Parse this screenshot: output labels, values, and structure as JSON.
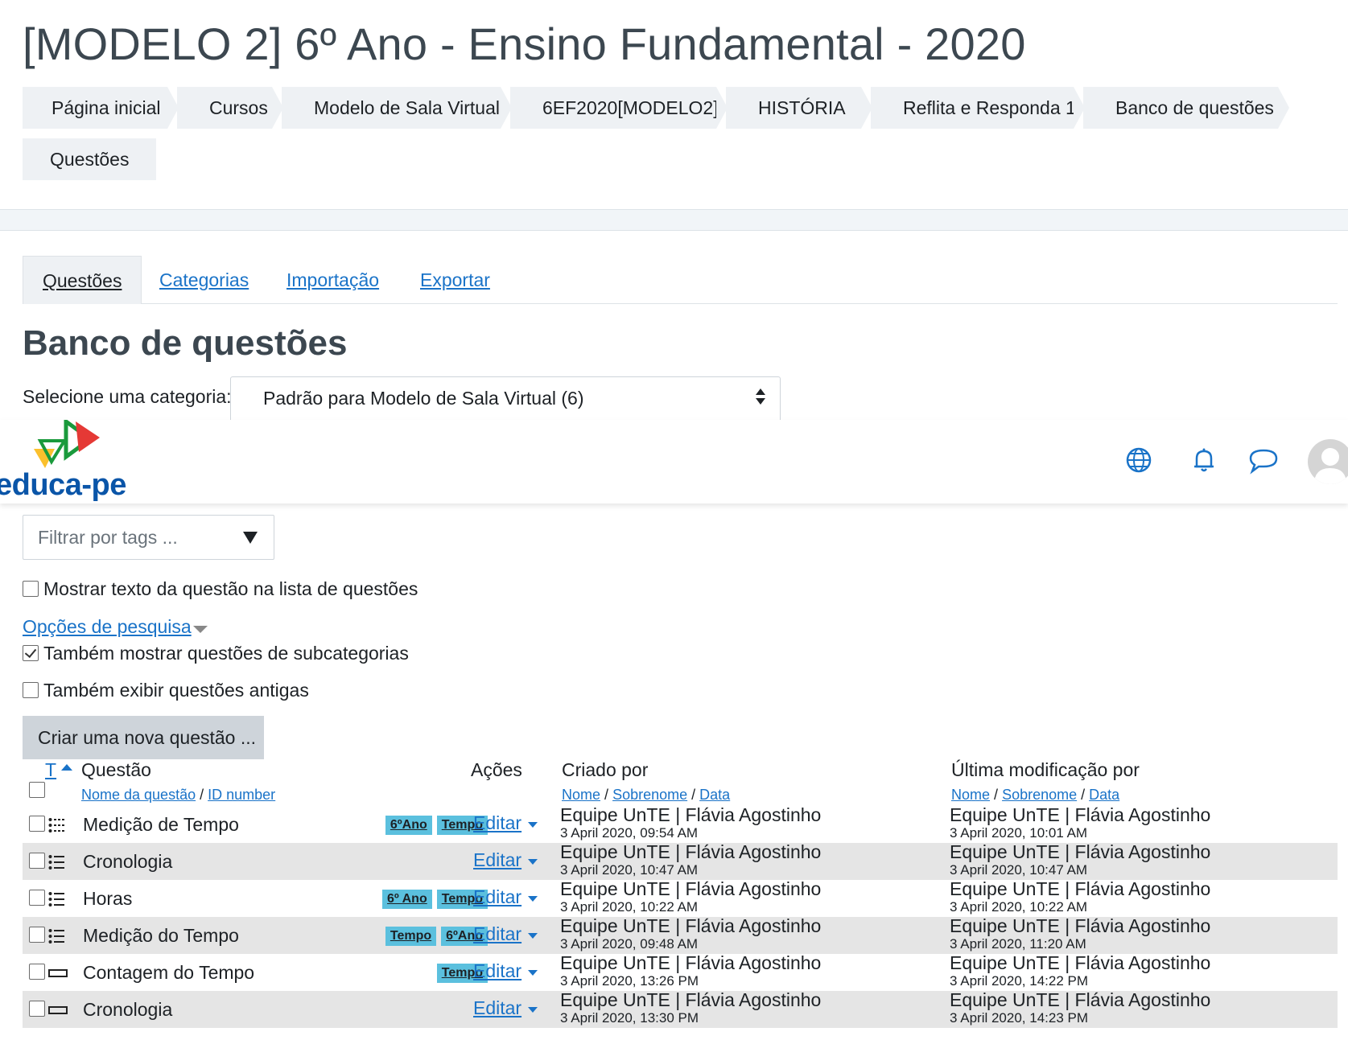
{
  "page_title": "[MODELO 2] 6º Ano - Ensino Fundamental - 2020",
  "breadcrumb": [
    "Página inicial",
    "Cursos",
    "Modelo de Sala Virtual",
    "6EF2020[MODELO2]",
    "HISTÓRIA",
    "Reflita e Responda 1",
    "Banco de questões",
    "Questões"
  ],
  "tabs": [
    "Questões",
    "Categorias",
    "Importação",
    "Exportar"
  ],
  "section_title": "Banco de questões",
  "category": {
    "label": "Selecione uma categoria:",
    "value": "Padrão para Modelo de Sala Virtual (6)"
  },
  "navbar": {
    "logo_text": "educa-pe",
    "icons": [
      "globe-icon",
      "bell-icon",
      "chat-icon",
      "user-avatar-icon"
    ]
  },
  "tag_filter": {
    "placeholder": "Filtrar por tags ..."
  },
  "options": {
    "show_text": {
      "label": "Mostrar texto da questão na lista de questões",
      "checked": false
    },
    "search_options": "Opções de pesquisa",
    "subcategories": {
      "label": "Também mostrar questões de subcategorias",
      "checked": true
    },
    "old_questions": {
      "label": "Também exibir questões antigas",
      "checked": false
    }
  },
  "create_button": "Criar uma nova questão ...",
  "table": {
    "headers": {
      "type": "T",
      "question": "Questão",
      "actions": "Ações",
      "created_by": "Criado por",
      "modified_by": "Última modificação por"
    },
    "question_sub": {
      "name": "Nome da questão",
      "sep": "/",
      "id": "ID number"
    },
    "person_sub": {
      "first": "Nome",
      "sep1": "/",
      "last": "Sobrenome",
      "sep2": "/",
      "date": "Data"
    },
    "edit_label": "Editar",
    "rows": [
      {
        "type": "multichoice-icon",
        "name": "Medição de Tempo",
        "tags": [
          "6ºAno",
          "Tempo"
        ],
        "created_by": "Equipe UnTE | Flávia Agostinho",
        "created": "3 April 2020, 09:54 AM",
        "modified_by": "Equipe UnTE | Flávia Agostinho",
        "modified": "3 April 2020, 10:01 AM"
      },
      {
        "type": "list-icon",
        "name": "Cronologia",
        "tags": [],
        "created_by": "Equipe UnTE | Flávia Agostinho",
        "created": "3 April 2020, 10:47 AM",
        "modified_by": "Equipe UnTE | Flávia Agostinho",
        "modified": "3 April 2020, 10:47 AM"
      },
      {
        "type": "list-icon",
        "name": "Horas",
        "tags": [
          "6º Ano",
          "Tempo"
        ],
        "created_by": "Equipe UnTE | Flávia Agostinho",
        "created": "3 April 2020, 10:22 AM",
        "modified_by": "Equipe UnTE | Flávia Agostinho",
        "modified": "3 April 2020, 10:22 AM"
      },
      {
        "type": "list-icon",
        "name": "Medição do Tempo",
        "tags": [
          "Tempo",
          "6ºAno"
        ],
        "created_by": "Equipe UnTE | Flávia Agostinho",
        "created": "3 April 2020, 09:48 AM",
        "modified_by": "Equipe UnTE | Flávia Agostinho",
        "modified": "3 April 2020, 11:20 AM"
      },
      {
        "type": "short-answer-icon",
        "name": "Contagem do Tempo",
        "tags": [
          "Tempo"
        ],
        "created_by": "Equipe UnTE | Flávia Agostinho",
        "created": "3 April 2020, 13:26 PM",
        "modified_by": "Equipe UnTE | Flávia Agostinho",
        "modified": "3 April 2020, 14:22 PM"
      },
      {
        "type": "short-answer-icon",
        "name": "Cronologia",
        "tags": [],
        "created_by": "Equipe UnTE | Flávia Agostinho",
        "created": "3 April 2020, 13:30 PM",
        "modified_by": "Equipe UnTE | Flávia Agostinho",
        "modified": "3 April 2020, 14:23 PM"
      }
    ]
  },
  "colors": {
    "link": "#1a73c8",
    "badge": "#5bc0de",
    "crumb_bg": "#eef1f4",
    "stripe": "#e5e5e5",
    "logo_blue": "#0a55a8"
  }
}
